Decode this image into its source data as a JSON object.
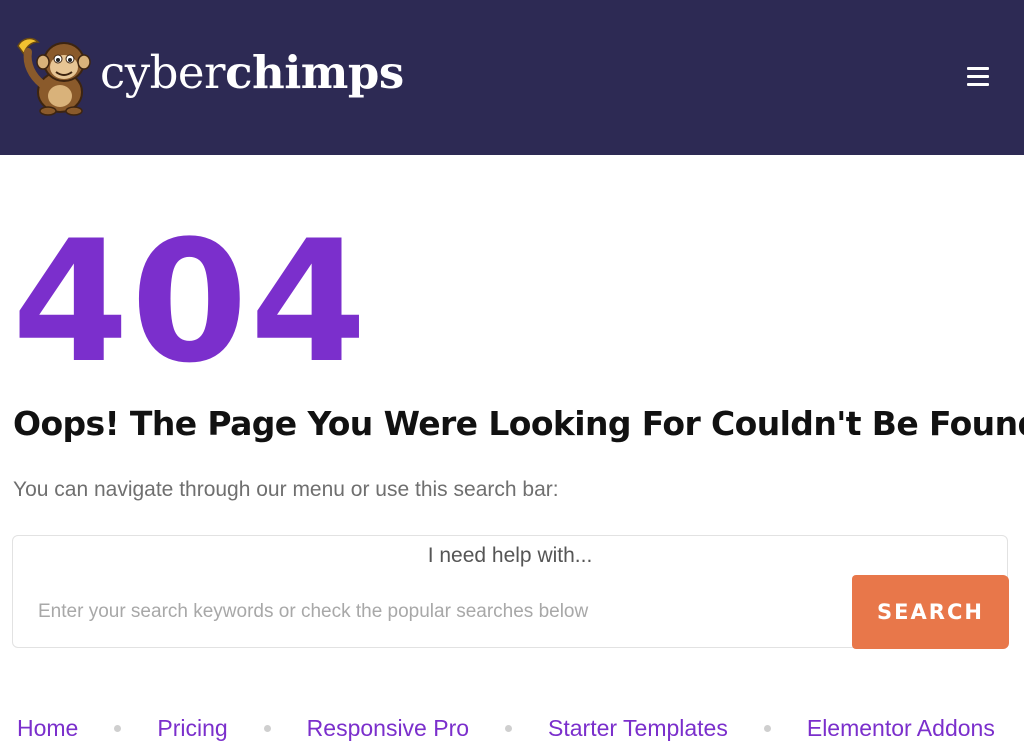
{
  "header": {
    "logo": {
      "name_part1": "cyber",
      "name_part2": "chimps",
      "mark_icon": "chimp-mascot-icon"
    },
    "menu_icon": "hamburger-menu-icon",
    "colors": {
      "background": "#2d2a54"
    }
  },
  "main": {
    "error_code": "404",
    "heading": "Oops! The Page You Were Looking For Couldn't Be Found",
    "subtext": "You can navigate through our menu or use this search bar:",
    "search": {
      "label": "I need help with...",
      "placeholder": "Enter your search keywords or check the popular searches below",
      "value": "",
      "button_label": "SEARCH"
    },
    "popular_links": [
      "Home",
      "Pricing",
      "Responsive Pro",
      "Starter Templates",
      "Elementor Addons"
    ]
  },
  "colors": {
    "accent": "#7b2fcc",
    "button": "#e8774a"
  }
}
